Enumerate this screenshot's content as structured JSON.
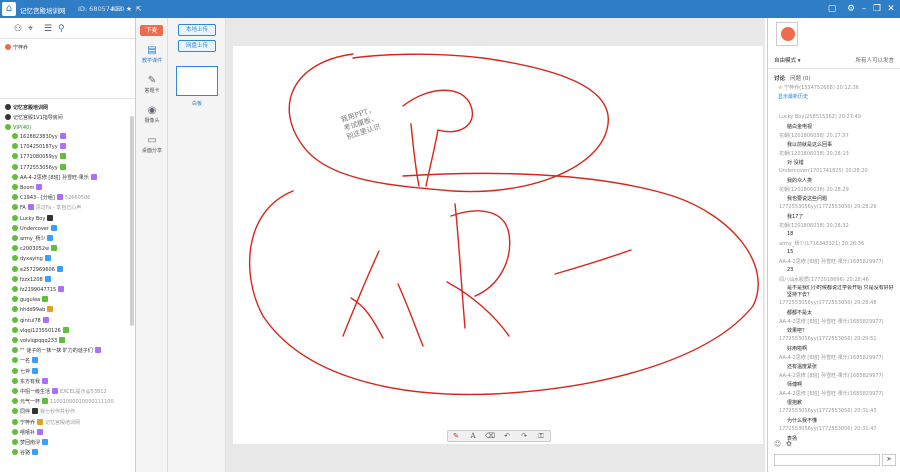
{
  "window": {
    "title": "记忆宫殿培训网",
    "room_id": "ID: 68057493",
    "users_count": "50"
  },
  "left": {
    "teacher": "宁梓乔",
    "sections": [
      {
        "label": "记忆宫殿培训网"
      },
      {
        "label": "记忆宫殿1V1指导房间"
      },
      {
        "label": "VIP(40)"
      }
    ],
    "users": [
      {
        "name": "1628823830yy",
        "badge": "#a970ff",
        "extra": ""
      },
      {
        "name": "1704250187yy",
        "badge": "#a970ff",
        "extra": ""
      },
      {
        "name": "1771080059yy",
        "badge": "#5fbf3a",
        "extra": ""
      },
      {
        "name": "1772553056yy",
        "badge": "#5fbf3a",
        "extra": ""
      },
      {
        "name": "AA-4-2思修 [8班] 孙雪旺-果乐",
        "badge": "#a970ff",
        "extra": ""
      },
      {
        "name": "Boom",
        "badge": "#a970ff",
        "extra": ""
      },
      {
        "name": "C1943···[分组]",
        "badge": "#a970ff",
        "extra": "52660506"
      },
      {
        "name": "FA",
        "badge": "#a970ff",
        "extra": "思过Fa - 享自己心声"
      },
      {
        "name": "Lucky Boy",
        "badge": "#333",
        "extra": ""
      },
      {
        "name": "Undercover",
        "badge": "#3aa0ff",
        "extra": ""
      },
      {
        "name": "army_杨少",
        "badge": "#3aa0ff",
        "extra": ""
      },
      {
        "name": "c2003052w",
        "badge": "#5fbf3a",
        "extra": ""
      },
      {
        "name": "dyxaying",
        "badge": "#3aa0ff",
        "extra": ""
      },
      {
        "name": "e2572969606",
        "badge": "#3aa0ff",
        "extra": ""
      },
      {
        "name": "fzzx1208",
        "badge": "#3aa0ff",
        "extra": ""
      },
      {
        "name": "fz2199047715",
        "badge": "#a970ff",
        "extra": ""
      },
      {
        "name": "gugulea",
        "badge": "#5fbf3a",
        "extra": ""
      },
      {
        "name": "hhdd99ab",
        "badge": "#e0a020",
        "extra": ""
      },
      {
        "name": "qinrui78",
        "badge": "#a970ff",
        "extra": ""
      },
      {
        "name": "vlqqi123550126",
        "badge": "#5fbf3a",
        "extra": ""
      },
      {
        "name": "volviqpqqq233",
        "badge": "#5fbf3a",
        "extra": ""
      },
      {
        "name": "\"\" 谜子的一抹一抹 旷力的谜子们",
        "badge": "#a970ff",
        "extra": ""
      },
      {
        "name": "一名",
        "badge": "#3aa0ff",
        "extra": ""
      },
      {
        "name": "七斧",
        "badge": "#3aa0ff",
        "extra": ""
      },
      {
        "name": "东方有我",
        "badge": "#a970ff",
        "extra": ""
      },
      {
        "name": "中招一级生活",
        "badge": "#a970ff",
        "extra": "EXCEL提示@53812"
      },
      {
        "name": "元气一杯",
        "badge": "#5fbf3a",
        "extra": "11001000010000111100"
      },
      {
        "name": "同伴",
        "badge": "#333",
        "extra": "我七秒作并秒作"
      },
      {
        "name": "宁梓乔",
        "badge": "#e0a020",
        "extra": "记忆宫殿培训网"
      },
      {
        "name": "嘻嘻补",
        "badge": "#a970ff",
        "extra": ""
      },
      {
        "name": "梦回南浔",
        "badge": "#3aa0ff",
        "extra": ""
      },
      {
        "name": "谷骆",
        "badge": "#3aa0ff",
        "extra": ""
      }
    ]
  },
  "tools": {
    "xiamai": "下麦",
    "items": [
      {
        "label": "教学课件"
      },
      {
        "label": "答题卡"
      },
      {
        "label": "摄像头"
      },
      {
        "label": "桌面分享"
      }
    ]
  },
  "courseware": {
    "local_upload": "本地上传",
    "net_upload": "网盘上传",
    "thumb_label": "白板"
  },
  "board": {
    "note": "我用PPT，\n考试模板，\n别这里认识"
  },
  "right": {
    "mode": "自由模式",
    "all_chat": "所有人可以发言",
    "tabs": [
      "讨论",
      "问题 (0)"
    ],
    "host_name": "宁梓乔(1534752668)",
    "host_time": "20:12:36",
    "history_link": "显示最新历史",
    "messages": [
      {
        "who": "Lucky Boy(258515362)",
        "time": "20:27:49",
        "text": "脑白金电视"
      },
      {
        "who": "花朝(1201806038)",
        "time": "20:27:57",
        "text": "我以前就是这么回事"
      },
      {
        "who": "花朝(1201806038)",
        "time": "20:28:13",
        "text": "对 没错"
      },
      {
        "who": "Undercover(1701741825)",
        "time": "20:28:20",
        "text": "我的众人类"
      },
      {
        "who": "花朝(1201806038)",
        "time": "20:28:29",
        "text": "我也要说这些问题"
      },
      {
        "who": "1772553056yy(1772553056)",
        "time": "20:28:29",
        "text": "我17了"
      },
      {
        "who": "花朝(1201806038)",
        "time": "20:28:32",
        "text": "18"
      },
      {
        "who": "army_杨少(1716343321)",
        "time": "20:28:36",
        "text": "15"
      },
      {
        "who": "AA-4-2思修 [8班] 孙雪旺-果乐(1685829977)",
        "time": "",
        "text": "23"
      },
      {
        "who": "闻八仙水胶质(1772018696)",
        "time": "20:28:46",
        "text": "是不是我们小时候都说过学会开始 只是没有好好坚持下去？"
      },
      {
        "who": "1772553056yy(1772553056)",
        "time": "20:28:48",
        "text": "都都不是太"
      },
      {
        "who": "AA-4-2思修 [8班] 孙雪旺-果乐(1685829977)",
        "time": "",
        "text": "效果吧？"
      },
      {
        "who": "1772553056yy(1772553056)",
        "time": "20:29:51",
        "text": "好用啦啊"
      },
      {
        "who": "AA-4-2思修 [8班] 孙雪旺-果乐(1685829977)",
        "time": "",
        "text": "还有温度紧张"
      },
      {
        "who": "AA-4-2思修 [8班] 孙雪旺-果乐(1685829977)",
        "time": "",
        "text": "师傅啊"
      },
      {
        "who": "AA-4-2思修 [8班] 孙雪旺-果乐(1685829977)",
        "time": "",
        "text": "很抱歉"
      },
      {
        "who": "1772553056yy(1772553056)",
        "time": "20:31:43",
        "text": "为什么我不懂"
      },
      {
        "who": "1772553056yy(1772553056)",
        "time": "20:31:47",
        "text": "表扬"
      }
    ]
  },
  "colors": {
    "brand": "#2e7dc5",
    "ink": "#d9261c",
    "raise": "#ef6b4c"
  }
}
